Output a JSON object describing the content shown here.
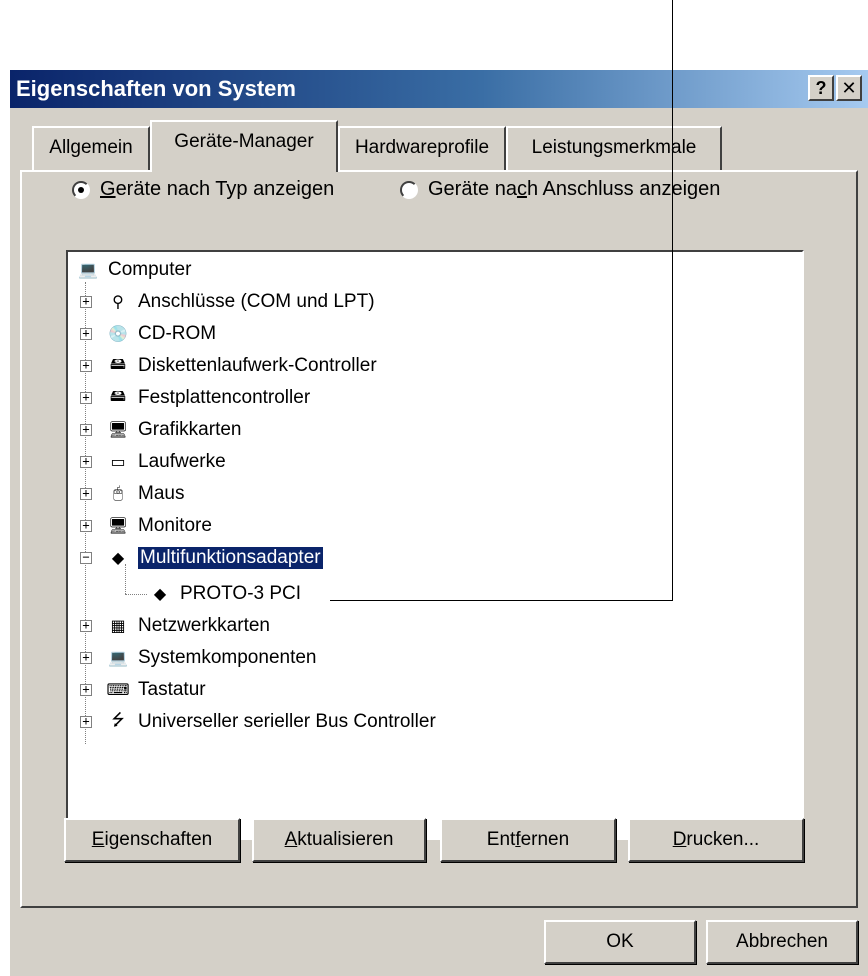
{
  "window": {
    "title": "Eigenschaften von System",
    "help_label": "?",
    "close_label": "✕"
  },
  "tabs": [
    {
      "label": "Allgemein",
      "active": false
    },
    {
      "label": "Geräte-Manager",
      "active": true
    },
    {
      "label": "Hardwareprofile",
      "active": false
    },
    {
      "label": "Leistungsmerkmale",
      "active": false
    }
  ],
  "view_options": {
    "by_type": {
      "prefix": "G",
      "rest": "eräte nach Typ anzeigen",
      "selected": true
    },
    "by_connection": {
      "before": "Geräte na",
      "mnemonic": "c",
      "after": "h Anschluss anzeigen",
      "selected": false
    }
  },
  "tree": {
    "root": {
      "label": "Computer",
      "icon": "computer-icon"
    },
    "items": [
      {
        "label": "Anschlüsse (COM und LPT)",
        "icon": "port-icon",
        "expander": "+"
      },
      {
        "label": "CD-ROM",
        "icon": "cdrom-icon",
        "expander": "+"
      },
      {
        "label": "Diskettenlaufwerk-Controller",
        "icon": "controller-icon",
        "expander": "+"
      },
      {
        "label": "Festplattencontroller",
        "icon": "controller-icon",
        "expander": "+"
      },
      {
        "label": "Grafikkarten",
        "icon": "display-icon",
        "expander": "+"
      },
      {
        "label": "Laufwerke",
        "icon": "drive-icon",
        "expander": "+"
      },
      {
        "label": "Maus",
        "icon": "mouse-icon",
        "expander": "+"
      },
      {
        "label": "Monitore",
        "icon": "monitor-icon",
        "expander": "+"
      },
      {
        "label": "Multifunktionsadapter",
        "icon": "multifunction-icon",
        "expander": "−",
        "selected": true
      },
      {
        "label": "PROTO-3 PCI",
        "icon": "multifunction-icon",
        "child": true
      },
      {
        "label": "Netzwerkkarten",
        "icon": "network-card-icon",
        "expander": "+"
      },
      {
        "label": "Systemkomponenten",
        "icon": "system-icon",
        "expander": "+"
      },
      {
        "label": "Tastatur",
        "icon": "keyboard-icon",
        "expander": "+"
      },
      {
        "label": "Universeller serieller Bus Controller",
        "icon": "usb-icon",
        "expander": "+"
      }
    ]
  },
  "buttons": {
    "properties": {
      "mn": "E",
      "rest": "igenschaften"
    },
    "refresh": {
      "mn": "A",
      "rest": "ktualisieren"
    },
    "remove": {
      "pre": "Ent",
      "mn": "f",
      "rest": "ernen"
    },
    "print": {
      "mn": "D",
      "rest": "rucken..."
    },
    "ok": "OK",
    "cancel": "Abbrechen"
  },
  "colors": {
    "selection": "#0a246a",
    "titlebar": "#0a246a",
    "face": "#d4d0c8"
  }
}
